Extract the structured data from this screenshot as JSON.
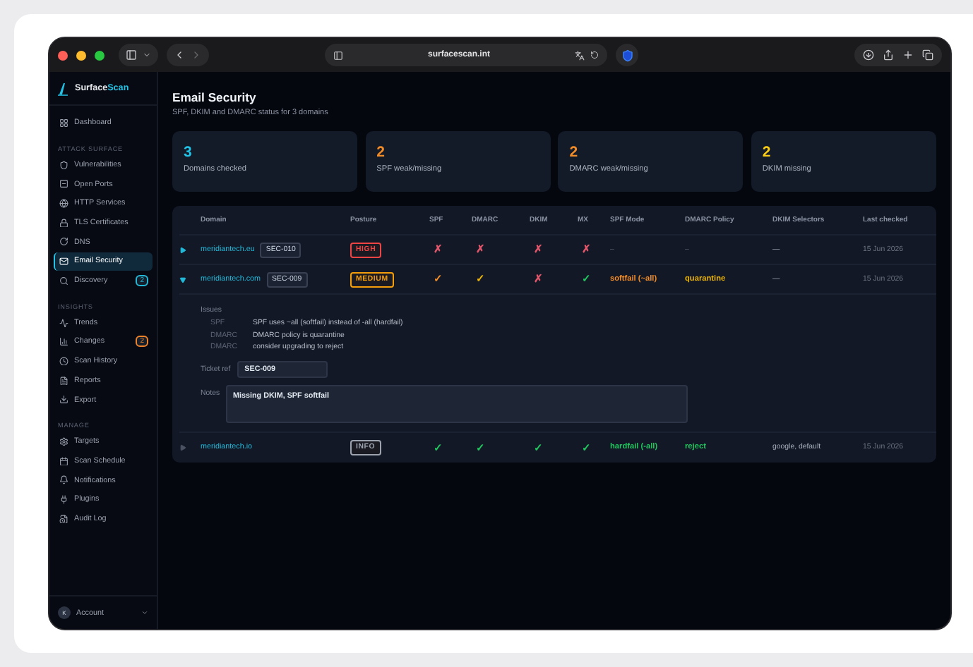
{
  "browser": {
    "url": "surfacescan.int"
  },
  "sidebar": {
    "brand": {
      "first": "Surface",
      "second": "Scan"
    },
    "sections": [
      {
        "items": [
          {
            "label": "Dashboard",
            "selected": false
          }
        ]
      },
      {
        "heading": "ATTACK SURFACE",
        "items": [
          {
            "label": "Vulnerabilities",
            "selected": false
          },
          {
            "label": "Open Ports",
            "selected": false
          },
          {
            "label": "HTTP Services",
            "selected": false
          },
          {
            "label": "TLS Certificates",
            "selected": false
          },
          {
            "label": "DNS",
            "selected": false
          },
          {
            "label": "Email Security",
            "selected": true
          },
          {
            "label": "Discovery",
            "selected": false,
            "badge": {
              "text": "2",
              "color": "#22b8d8"
            }
          }
        ]
      },
      {
        "heading": "INSIGHTS",
        "items": [
          {
            "label": "Trends",
            "selected": false
          },
          {
            "label": "Changes",
            "selected": false,
            "badge": {
              "text": "2",
              "color": "#f0822a"
            }
          },
          {
            "label": "Scan History",
            "selected": false
          },
          {
            "label": "Reports",
            "selected": false
          },
          {
            "label": "Export",
            "selected": false
          }
        ]
      },
      {
        "heading": "MANAGE",
        "items": [
          {
            "label": "Targets",
            "selected": false
          },
          {
            "label": "Scan Schedule",
            "selected": false
          },
          {
            "label": "Notifications",
            "selected": false
          },
          {
            "label": "Plugins",
            "selected": false
          },
          {
            "label": "Audit Log",
            "selected": false
          }
        ]
      }
    ],
    "account": {
      "initial": "K",
      "label": "Account"
    }
  },
  "page": {
    "title": "Email Security",
    "subtitle": "SPF, DKIM and DMARC status for 3 domains"
  },
  "stats": [
    {
      "value": "3",
      "label": "Domains checked",
      "color": "#22c3e6"
    },
    {
      "value": "2",
      "label": "SPF weak/missing",
      "color": "#f28c28"
    },
    {
      "value": "2",
      "label": "DMARC weak/missing",
      "color": "#f28c28"
    },
    {
      "value": "2",
      "label": "DKIM missing",
      "color": "#facc15"
    }
  ],
  "table": {
    "columns": [
      "Domain",
      "Posture",
      "SPF",
      "DMARC",
      "DKIM",
      "MX",
      "SPF Mode",
      "DMARC Policy",
      "DKIM Selectors",
      "Last checked"
    ],
    "rows": [
      {
        "expanded": false,
        "domain": "meridiantech.eu",
        "ticket": "SEC-010",
        "posture": {
          "label": "HIGH",
          "color": "#ef4444"
        },
        "checks": [
          {
            "mark": "✗",
            "color": "#e0566a"
          },
          {
            "mark": "✗",
            "color": "#e0566a"
          },
          {
            "mark": "✗",
            "color": "#e0566a"
          },
          {
            "mark": "✗",
            "color": "#e0566a"
          }
        ],
        "spf_mode": {
          "text": "–"
        },
        "dmarc_policy": {
          "text": "–"
        },
        "dkim_selectors": "—",
        "last_checked": "15 Jun 2026"
      },
      {
        "expanded": true,
        "domain": "meridiantech.com",
        "ticket": "SEC-009",
        "posture": {
          "label": "MEDIUM",
          "color": "#f59e0b"
        },
        "checks": [
          {
            "mark": "✓",
            "color": "#f28c28"
          },
          {
            "mark": "✓",
            "color": "#eab308"
          },
          {
            "mark": "✗",
            "color": "#e0566a"
          },
          {
            "mark": "✓",
            "color": "#22c55e"
          }
        ],
        "spf_mode": {
          "text": "softfail (~all)",
          "color": "#f28c28"
        },
        "dmarc_policy": {
          "text": "quarantine",
          "color": "#eab308"
        },
        "dkim_selectors": "—",
        "last_checked": "15 Jun 2026",
        "details": {
          "issues_label": "Issues",
          "issues": [
            {
              "tag": "SPF",
              "text": "SPF uses ~all (softfail) instead of -all (hardfail)"
            },
            {
              "tag": "DMARC",
              "text": "DMARC policy is quarantine"
            },
            {
              "tag": "DMARC",
              "text": "consider upgrading to reject"
            }
          ],
          "ticket_label": "Ticket ref",
          "ticket_value": "SEC-009",
          "notes_label": "Notes",
          "notes_value": "Missing DKIM, SPF softfail"
        }
      },
      {
        "expanded": false,
        "domain": "meridiantech.io",
        "posture": {
          "label": "INFO",
          "color": "#9ca3af"
        },
        "checks": [
          {
            "mark": "✓",
            "color": "#22c55e"
          },
          {
            "mark": "✓",
            "color": "#22c55e"
          },
          {
            "mark": "✓",
            "color": "#22c55e"
          },
          {
            "mark": "✓",
            "color": "#22c55e"
          }
        ],
        "spf_mode": {
          "text": "hardfail (-all)",
          "color": "#22c55e"
        },
        "dmarc_policy": {
          "text": "reject",
          "color": "#22c55e"
        },
        "dkim_selectors": "google, default",
        "last_checked": "15 Jun 2026"
      }
    ]
  }
}
